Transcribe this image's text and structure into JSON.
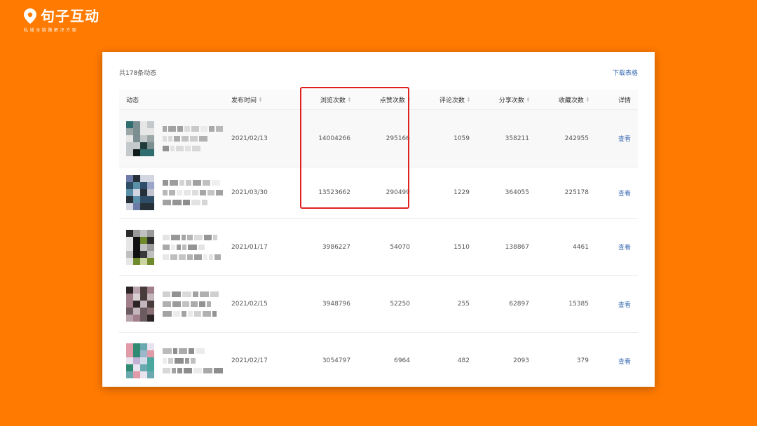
{
  "brand": {
    "name": "句子互动",
    "tagline": "私域全链路解决方案",
    "color": "#ffffff"
  },
  "page": {
    "background": "#ff7a00"
  },
  "table_meta": {
    "total_text": "共178条动态",
    "download_label": "下载表格",
    "link_color": "#3f6fb5",
    "highlight_color": "#e02020"
  },
  "columns": {
    "post": "动态",
    "date": "发布时间",
    "views": "浏览次数",
    "likes": "点赞次数",
    "comments": "评论次数",
    "shares": "分享次数",
    "favorites": "收藏次数",
    "detail": "详情"
  },
  "rows": [
    {
      "date": "2021/02/13",
      "views": "14004266",
      "likes": "295166",
      "comments": "1059",
      "shares": "358211",
      "favorites": "242955",
      "detail": "查看"
    },
    {
      "date": "2021/03/30",
      "views": "13523662",
      "likes": "290499",
      "comments": "1229",
      "shares": "364055",
      "favorites": "225178",
      "detail": "查看"
    },
    {
      "date": "2021/01/17",
      "views": "3986227",
      "likes": "54070",
      "comments": "1510",
      "shares": "138867",
      "favorites": "4461",
      "detail": "查看"
    },
    {
      "date": "2021/02/15",
      "views": "3948796",
      "likes": "52250",
      "comments": "255",
      "shares": "62897",
      "favorites": "15385",
      "detail": "查看"
    },
    {
      "date": "2021/02/17",
      "views": "3054797",
      "likes": "6964",
      "comments": "482",
      "shares": "2093",
      "favorites": "379",
      "detail": "查看"
    }
  ],
  "icons": {
    "brand": "location-pin-icon",
    "sort": "sort-arrows-icon"
  }
}
